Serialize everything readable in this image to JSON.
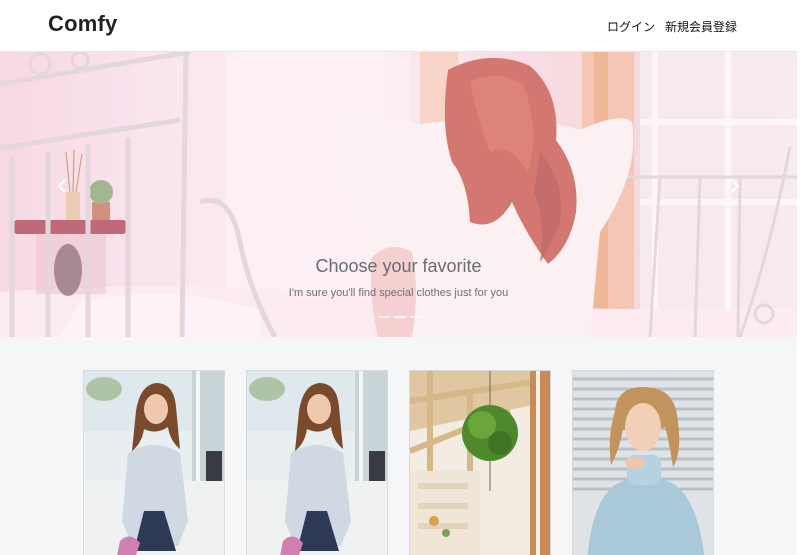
{
  "navbar": {
    "brand": "Comfy",
    "links": [
      {
        "label": "ログイン"
      },
      {
        "label": "新規会員登録"
      }
    ]
  },
  "hero": {
    "title": "Choose your favorite",
    "subtitle": "I'm sure you'll find special clothes just for you",
    "controls": {
      "prev_icon": "chevron-left-icon",
      "next_icon": "chevron-right-icon"
    },
    "slides_count": 3,
    "active_slide": 2
  },
  "products": [
    {
      "image": "woman-denim-shirt-photo"
    },
    {
      "image": "woman-denim-shirt-photo"
    },
    {
      "image": "shop-interior-plants-photo"
    },
    {
      "image": "woman-turtleneck-sweater-photo"
    }
  ]
}
